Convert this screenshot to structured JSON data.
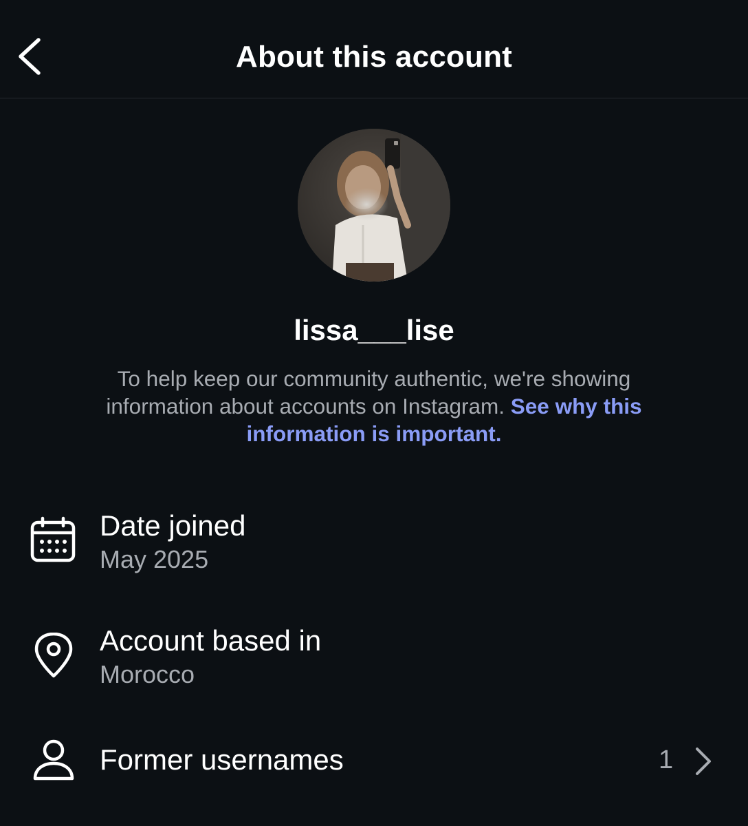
{
  "header": {
    "title": "About this account",
    "back_icon": "chevron-left-icon"
  },
  "profile": {
    "avatar_icon": "profile-photo",
    "username": "lissa___lise"
  },
  "info": {
    "text": "To help keep our community authentic, we're showing information about accounts on Instagram.",
    "link_text": "See why this information is important."
  },
  "rows": {
    "date_joined": {
      "icon": "calendar-icon",
      "title": "Date joined",
      "value": "May 2025"
    },
    "account_based_in": {
      "icon": "location-pin-icon",
      "title": "Account based in",
      "value": "Morocco"
    },
    "former_usernames": {
      "icon": "person-icon",
      "title": "Former usernames",
      "count": "1",
      "chevron": "chevron-right-icon"
    }
  },
  "colors": {
    "background": "#0c1014",
    "text_primary": "#ffffff",
    "text_secondary": "#a8acb2",
    "link": "#8a9cf6",
    "divider": "#262a2f"
  }
}
